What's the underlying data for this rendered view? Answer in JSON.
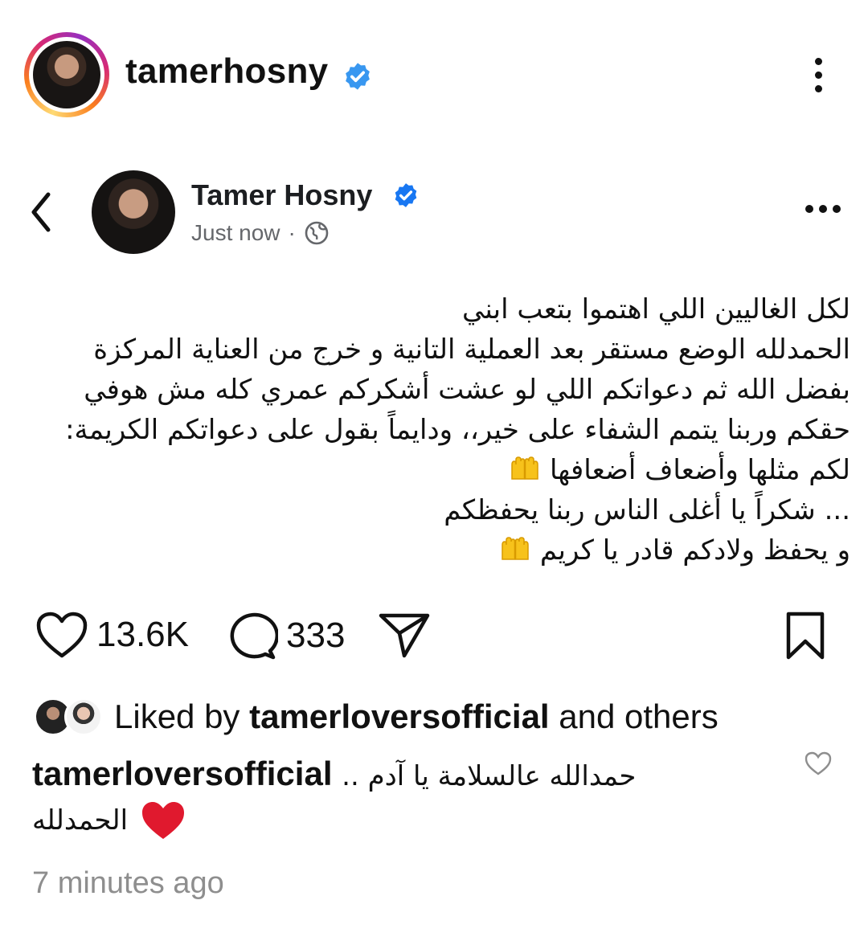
{
  "instagram_header": {
    "username": "tamerhosny",
    "verified_color": "#3897f0"
  },
  "fb_post": {
    "author": "Tamer Hosny",
    "timestamp": "Just now",
    "separator": "·",
    "verified_color": "#1877f2",
    "text_lines": [
      "لكل الغاليين اللي اهتموا بتعب ابني",
      "الحمدلله الوضع مستقر بعد العملية التانية و خرج من العناية المركزة",
      "بفضل الله ثم دعواتكم اللي لو عشت أشكركم عمري كله مش هوفي",
      "حقكم وربنا يتمم الشفاء على خير،، ودايماً بقول على دعواتكم الكريمة:",
      "لكم مثلها وأضعاف أضعافها",
      "... شكراً يا أغلى الناس ربنا يحفظكم",
      "و يحفظ ولادكم قادر يا كريم"
    ]
  },
  "actions": {
    "likes": "13.6K",
    "comments": "333"
  },
  "liked_by": {
    "prefix": "Liked by ",
    "user": "tamerloversofficial",
    "suffix": " and others"
  },
  "comment": {
    "user": "tamerloversofficial",
    "text": "حمدالله عالسلامة يا آدم ..",
    "text_line2": "الحمدلله"
  },
  "time_ago": "7 minutes ago",
  "icons": [
    "verified-badge-icon",
    "more-vertical-icon",
    "back-chevron-icon",
    "globe-icon",
    "more-horizontal-icon",
    "heart-icon",
    "comment-icon",
    "share-icon",
    "bookmark-icon",
    "raising-hands-emoji",
    "red-heart-emoji"
  ]
}
